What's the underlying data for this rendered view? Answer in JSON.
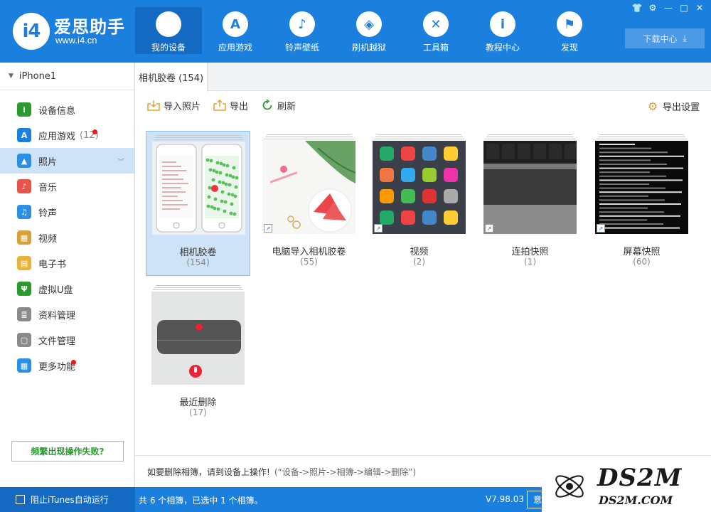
{
  "app": {
    "logo_text": "爱思助手",
    "logo_url": "www.i4.cn",
    "logo_badge": "i4"
  },
  "nav": [
    {
      "label": "我的设备",
      "icon": "apple-icon",
      "glyph": "",
      "active": true
    },
    {
      "label": "应用游戏",
      "icon": "app-store-icon",
      "glyph": "A"
    },
    {
      "label": "铃声壁纸",
      "icon": "music-box-icon",
      "glyph": "♪"
    },
    {
      "label": "刷机越狱",
      "icon": "dropbox-icon",
      "glyph": "◈"
    },
    {
      "label": "工具箱",
      "icon": "tools-icon",
      "glyph": "✕"
    },
    {
      "label": "教程中心",
      "icon": "info-icon",
      "glyph": "i"
    },
    {
      "label": "发现",
      "icon": "flag-icon",
      "glyph": "⚑"
    }
  ],
  "window_controls": [
    "👕",
    "⚙",
    "—",
    "□",
    "✕"
  ],
  "download_center": "下载中心",
  "device": {
    "name": "iPhone1"
  },
  "sidebar": [
    {
      "label": "设备信息",
      "icon": "info-circle-icon",
      "color": "#2a9a2e",
      "glyph": "i"
    },
    {
      "label": "应用游戏",
      "icon": "app-store-icon",
      "color": "#1b7fde",
      "glyph": "A",
      "count": "(12)",
      "dot": true
    },
    {
      "label": "照片",
      "icon": "photo-icon",
      "color": "#2b8fe6",
      "glyph": "▲",
      "active": true
    },
    {
      "label": "音乐",
      "icon": "music-icon",
      "color": "#e8534a",
      "glyph": "♪"
    },
    {
      "label": "铃声",
      "icon": "bell-icon",
      "color": "#2b8fe6",
      "glyph": "♫"
    },
    {
      "label": "视频",
      "icon": "film-icon",
      "color": "#d9a13b",
      "glyph": "▦"
    },
    {
      "label": "电子书",
      "icon": "book-icon",
      "color": "#e8b33a",
      "glyph": "▤"
    },
    {
      "label": "虚拟U盘",
      "icon": "usb-icon",
      "color": "#2a9a2e",
      "glyph": "Ψ"
    },
    {
      "label": "资料管理",
      "icon": "contacts-icon",
      "color": "#8a8a8a",
      "glyph": "≣"
    },
    {
      "label": "文件管理",
      "icon": "file-icon",
      "color": "#8a8a8a",
      "glyph": "▢"
    },
    {
      "label": "更多功能",
      "icon": "grid-icon",
      "color": "#2b8fe6",
      "glyph": "▦",
      "dot": true
    }
  ],
  "fail_button": "频繁出现操作失败?",
  "tab": {
    "label": "相机胶卷 (154)"
  },
  "toolbar": {
    "import": "导入照片",
    "export": "导出",
    "refresh": "刷新",
    "export_settings": "导出设置"
  },
  "albums": [
    {
      "name": "相机胶卷",
      "count": "(154)",
      "thumb": "phones",
      "selected": true
    },
    {
      "name": "电脑导入相机胶卷",
      "count": "(55)",
      "thumb": "watermelon",
      "link": true
    },
    {
      "name": "视频",
      "count": "(2)",
      "thumb": "homescreen",
      "link": true
    },
    {
      "name": "连拍快照",
      "count": "(1)",
      "thumb": "keyboard",
      "link": true
    },
    {
      "name": "屏幕快照",
      "count": "(60)",
      "thumb": "terminal",
      "link": true
    },
    {
      "name": "最近删除",
      "count": "(17)",
      "thumb": "recording"
    }
  ],
  "hint": {
    "main": "如要删除相簿，请到设备上操作!",
    "sub": "(“设备->照片->相簿->编辑->删除”)"
  },
  "status": {
    "itunes_block": "阻止iTunes自动运行",
    "summary": "共 6 个相簿，已选中 1 个相簿。",
    "version": "V7.98.03",
    "button": "意"
  },
  "watermark": {
    "main": "DS2M",
    "sub": "DS2M.COM"
  }
}
